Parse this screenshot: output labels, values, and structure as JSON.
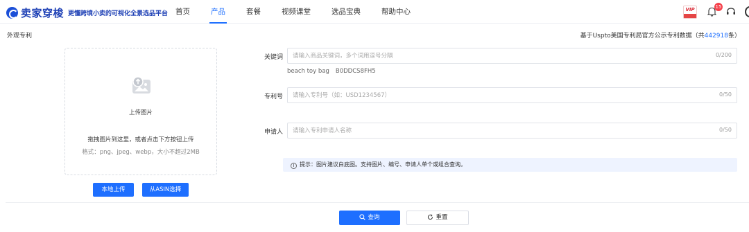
{
  "header": {
    "brand_name": "卖家穿梭",
    "slogan": "更懂跨境小卖的可视化全景选品平台",
    "nav": [
      {
        "label": "首页",
        "active": false
      },
      {
        "label": "产品",
        "active": true
      },
      {
        "label": "套餐",
        "active": false
      },
      {
        "label": "视频课堂",
        "active": false
      },
      {
        "label": "选品宝典",
        "active": false
      },
      {
        "label": "帮助中心",
        "active": false
      }
    ],
    "vip_label": "VIP",
    "notification_count": "15"
  },
  "page": {
    "section_title": "外观专利",
    "data_note_prefix": "基于Uspto美国专利局官方公示专利数据（共",
    "data_note_count": "442918",
    "data_note_suffix": "条）"
  },
  "upload": {
    "title": "上传图片",
    "hint": "拖拽图片到这里，或者点击下方按钮上传",
    "format": "格式：png、jpeg、webp，大小不超过2MB",
    "local_button": "本地上传",
    "asin_button": "从ASIN选择"
  },
  "form": {
    "keyword": {
      "label": "关键词",
      "placeholder": "请输入商品关键词，多个词用逗号分隔",
      "counter": "0/200",
      "tags": [
        "beach toy bag",
        "B0DDCS8FH5"
      ]
    },
    "patent_no": {
      "label": "专利号",
      "placeholder": "请输入专利号（如：USD1234567）",
      "counter": "0/50"
    },
    "applicant": {
      "label": "申请人",
      "placeholder": "请输入专利申请人名称",
      "counter": "0/50"
    },
    "tip": "提示：图片建议白底图。支持图片、编号、申请人单个或组合查询。"
  },
  "actions": {
    "query": "查询",
    "reset": "重置"
  },
  "colors": {
    "accent": "#1e6fff",
    "brand": "#1c3fb5",
    "tip_bg": "#eef3ff",
    "badge": "#f5404a"
  }
}
